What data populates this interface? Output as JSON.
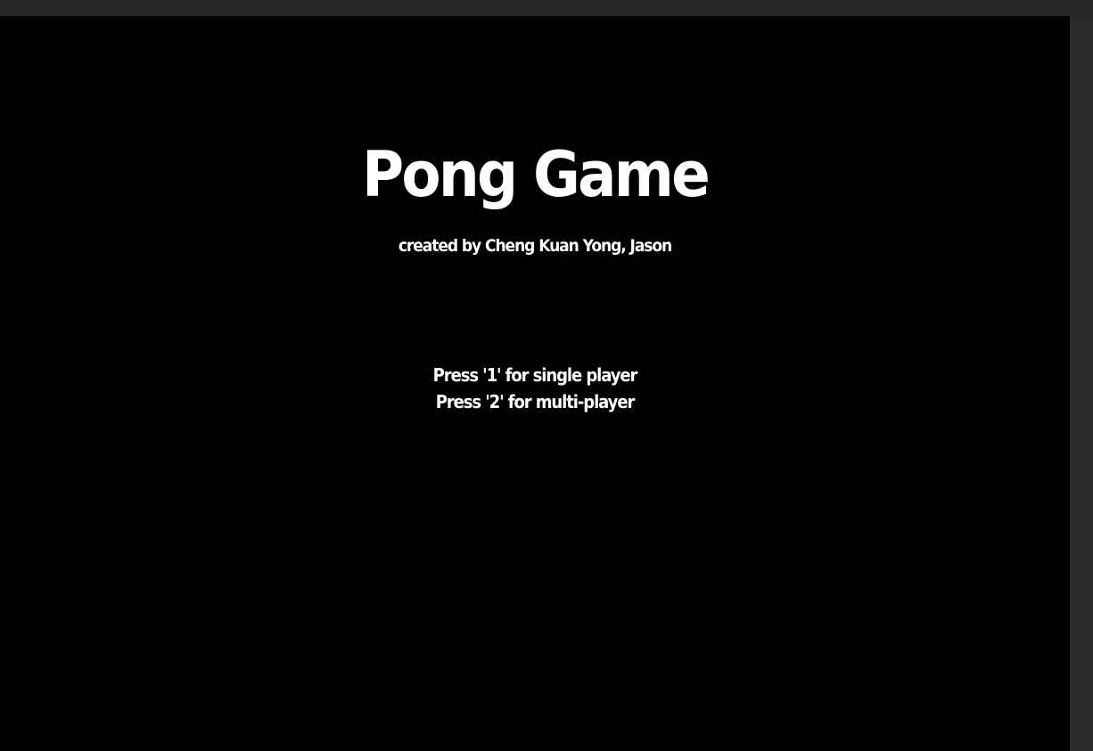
{
  "game": {
    "title": "Pong Game",
    "subtitle": "created by Cheng Kuan Yong, Jason",
    "menu": {
      "single_player": "Press '1' for single player",
      "multi_player": "Press '2' for multi-player"
    }
  },
  "colors": {
    "background": "#000000",
    "text": "#ffffff",
    "window_frame": "#262626"
  }
}
